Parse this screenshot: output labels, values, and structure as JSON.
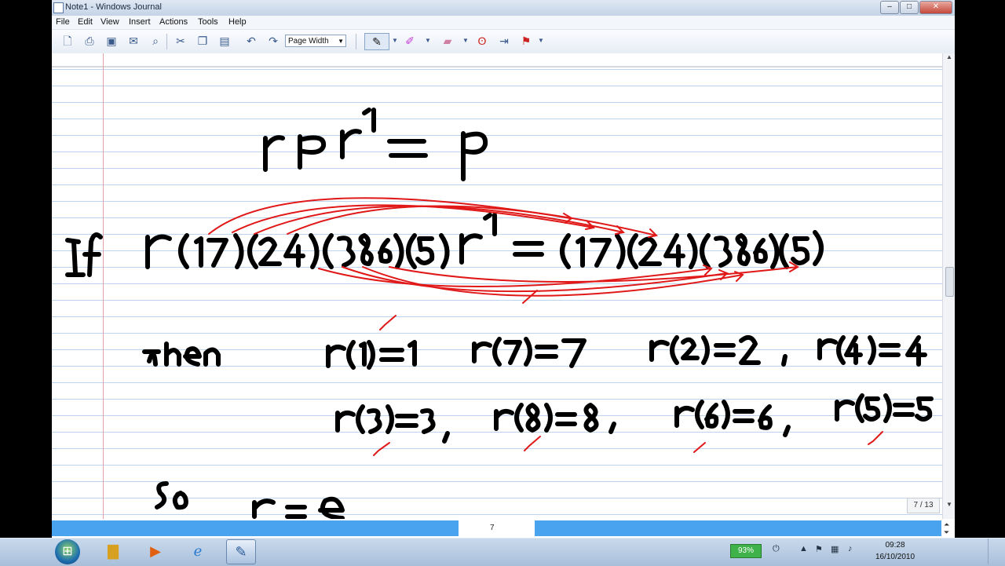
{
  "window": {
    "title": "Note1 - Windows Journal"
  },
  "menu": [
    "File",
    "Edit",
    "View",
    "Insert",
    "Actions",
    "Tools",
    "Help"
  ],
  "toolbar": {
    "zoom": "Page Width"
  },
  "page": {
    "counter": "7 / 13",
    "number": "7",
    "ink_text": {
      "line1": "r p r⁻¹ = p",
      "line2_if": "If",
      "line2": "r(17)(24)(386)(5) r⁻¹ = (17)(24)(386)(5)",
      "line3_then": "then",
      "line3": [
        "r(1)=1",
        "r(7)=7",
        "r(2)=2",
        ",",
        "r(4)=4"
      ],
      "line4": [
        "r(3)=3,",
        "r(8)=8,",
        "r(6)=6,",
        "r(5)=5"
      ],
      "line5_so": "so",
      "line5": "r = e"
    }
  },
  "taskbar": {
    "battery": "93%",
    "time": "09:28",
    "date": "16/10/2010"
  },
  "colors": {
    "ink": "#000000",
    "annotation": "#e01818",
    "page_bar": "#4aa3ee"
  }
}
